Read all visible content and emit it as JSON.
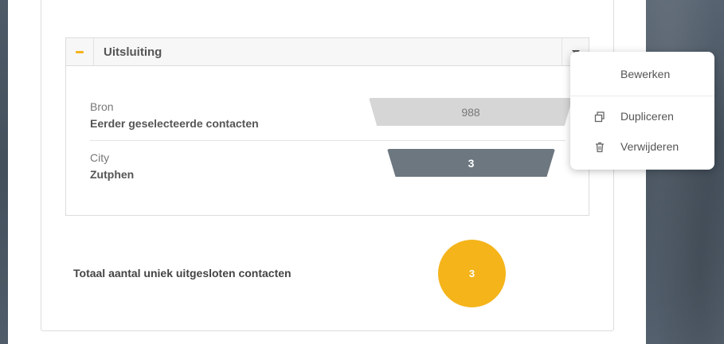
{
  "panel": {
    "title": "Uitsluiting",
    "rows": [
      {
        "label": "Bron",
        "value": "Eerder geselecteerde contacten",
        "count": "988"
      },
      {
        "label": "City",
        "value": "Zutphen",
        "count": "3"
      }
    ]
  },
  "total": {
    "label": "Totaal aantal uniek uitgesloten contacten",
    "count": "3"
  },
  "menu": {
    "items": [
      {
        "label": "Bewerken",
        "icon": "none"
      },
      {
        "label": "Dupliceren",
        "icon": "duplicate-icon"
      },
      {
        "label": "Verwijderen",
        "icon": "trash-icon"
      }
    ]
  },
  "colors": {
    "accent": "#f4b41a",
    "funnel_primary": "#6d7780",
    "funnel_secondary": "#d6d6d6"
  }
}
